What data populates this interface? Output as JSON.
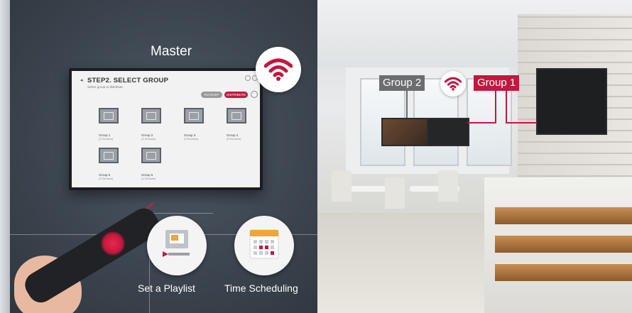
{
  "master": {
    "label": "Master"
  },
  "screen": {
    "title": "STEP2. SELECT GROUP",
    "subtitle": "Select group to distribute.",
    "buttons": [
      "PLAYLIST",
      "DISTRIBUTE"
    ],
    "groups": [
      {
        "name": "Group 1",
        "count": "(3 Devices)"
      },
      {
        "name": "Group 2",
        "count": "(4 Devices)"
      },
      {
        "name": "Group 3",
        "count": "(3 Devices)"
      },
      {
        "name": "Group 4",
        "count": "(5 Devices)"
      },
      {
        "name": "Group 5",
        "count": "(3 Devices)"
      },
      {
        "name": "Group 6",
        "count": "(4 Devices)"
      }
    ]
  },
  "features": {
    "playlist": {
      "label": "Set a Playlist",
      "icon": "playlist-icon"
    },
    "schedule": {
      "label": "Time Scheduling",
      "icon": "calendar-icon"
    }
  },
  "groups_tags": {
    "group2": "Group 2",
    "group1": "Group 1"
  },
  "colors": {
    "accent": "#c4173f",
    "tag_grey": "#6b6e70",
    "panel_dark": "#3c454f"
  },
  "icons": {
    "wifi": "wifi-icon"
  }
}
